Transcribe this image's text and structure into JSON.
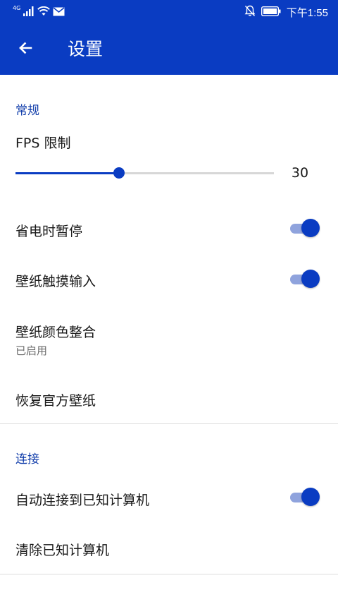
{
  "status_bar": {
    "time": "下午1:55",
    "network_label": "4G",
    "icons": [
      "signal-icon",
      "wifi-icon",
      "mail-icon",
      "notifications-off-icon",
      "battery-icon"
    ]
  },
  "app_bar": {
    "title": "设置",
    "back_icon": "arrow-back-icon",
    "color": "#0a3cc2"
  },
  "sections": {
    "general": {
      "header": "常规",
      "fps": {
        "title": "FPS 限制",
        "value": "30",
        "fill_fraction": 0.4
      },
      "pause_on_power_save": {
        "title": "省电时暂停",
        "on": true
      },
      "wallpaper_touch_input": {
        "title": "壁纸触摸输入",
        "on": true
      },
      "wallpaper_color_integration": {
        "title": "壁纸颜色整合",
        "subtitle": "已启用"
      },
      "restore_official_wallpaper": {
        "title": "恢复官方壁纸"
      }
    },
    "connection": {
      "header": "连接",
      "auto_connect": {
        "title": "自动连接到已知计算机",
        "on": true
      },
      "clear_known": {
        "title": "清除已知计算机"
      }
    }
  },
  "accent_color": "#0a3cc2"
}
